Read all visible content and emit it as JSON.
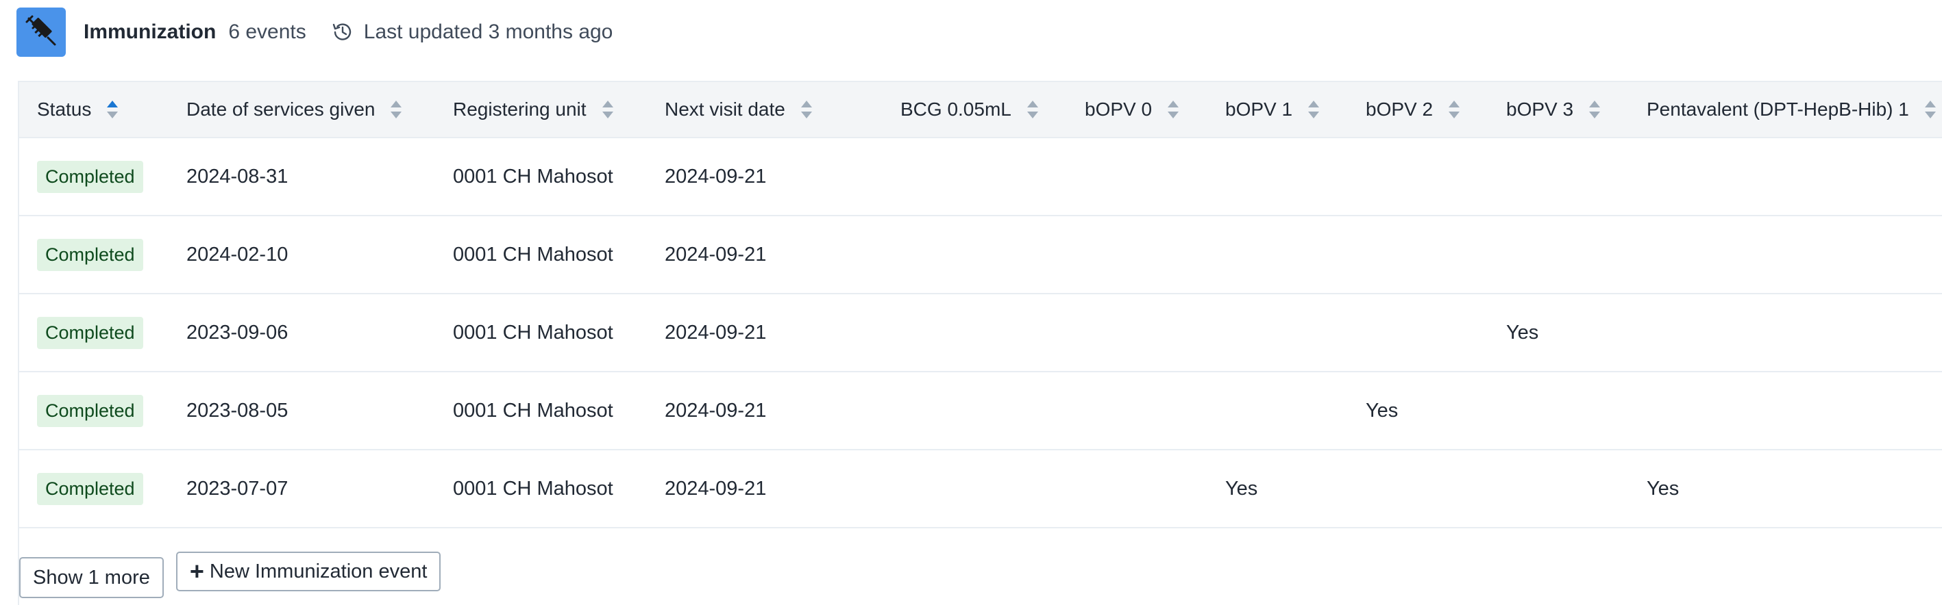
{
  "header": {
    "title": "Immunization",
    "event_count": "6 events",
    "last_updated": "Last updated 3 months ago",
    "icon": "syringe-icon",
    "icon_bg": "#4a93ea"
  },
  "table": {
    "columns": [
      "Status",
      "Date of services given",
      "Registering unit",
      "Next visit date",
      "BCG 0.05mL",
      "bOPV 0",
      "bOPV 1",
      "bOPV 2",
      "bOPV 3",
      "Pentavalent (DPT-HepB-Hib) 1"
    ],
    "rows": [
      {
        "status": "Completed",
        "date": "2024-08-31",
        "unit": "0001 CH Mahosot",
        "next": "2024-09-21",
        "bcg": "",
        "bopv0": "",
        "bopv1": "",
        "bopv2": "",
        "bopv3": "",
        "penta1": ""
      },
      {
        "status": "Completed",
        "date": "2024-02-10",
        "unit": "0001 CH Mahosot",
        "next": "2024-09-21",
        "bcg": "",
        "bopv0": "",
        "bopv1": "",
        "bopv2": "",
        "bopv3": "",
        "penta1": ""
      },
      {
        "status": "Completed",
        "date": "2023-09-06",
        "unit": "0001 CH Mahosot",
        "next": "2024-09-21",
        "bcg": "",
        "bopv0": "",
        "bopv1": "",
        "bopv2": "",
        "bopv3": "Yes",
        "penta1": ""
      },
      {
        "status": "Completed",
        "date": "2023-08-05",
        "unit": "0001 CH Mahosot",
        "next": "2024-09-21",
        "bcg": "",
        "bopv0": "",
        "bopv1": "",
        "bopv2": "Yes",
        "bopv3": "",
        "penta1": ""
      },
      {
        "status": "Completed",
        "date": "2023-07-07",
        "unit": "0001 CH Mahosot",
        "next": "2024-09-21",
        "bcg": "",
        "bopv0": "",
        "bopv1": "Yes",
        "bopv2": "",
        "bopv3": "",
        "penta1": "Yes"
      }
    ],
    "sort": {
      "column": "Status",
      "direction": "ascending"
    }
  },
  "footer": {
    "show_more_label": "Show 1 more",
    "new_event_label": "New Immunization event"
  },
  "colors": {
    "status_badge_bg": "#e1f3e4",
    "status_badge_text": "#0e4a1d",
    "sort_active": "#1976d2",
    "sort_inactive": "#a0adba"
  }
}
